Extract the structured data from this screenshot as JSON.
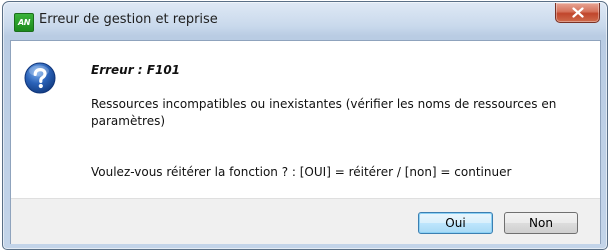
{
  "window": {
    "title": "Erreur de gestion et reprise",
    "app_icon_text": "AN"
  },
  "message": {
    "title": "Erreur : F101",
    "body": "Ressources incompatibles ou inexistantes (vérifier les noms de ressources en paramètres)",
    "question": "Voulez-vous réitérer la fonction ? : [OUI] = réitérer / [non] = continuer"
  },
  "buttons": {
    "oui": "Oui",
    "non": "Non"
  },
  "icons": {
    "app": "app-logo-icon",
    "close": "close-icon",
    "question": "question-icon"
  },
  "colors": {
    "close_button": "#c0462c",
    "question_icon": "#2a62b8",
    "default_button_border": "#3c7fb1"
  }
}
